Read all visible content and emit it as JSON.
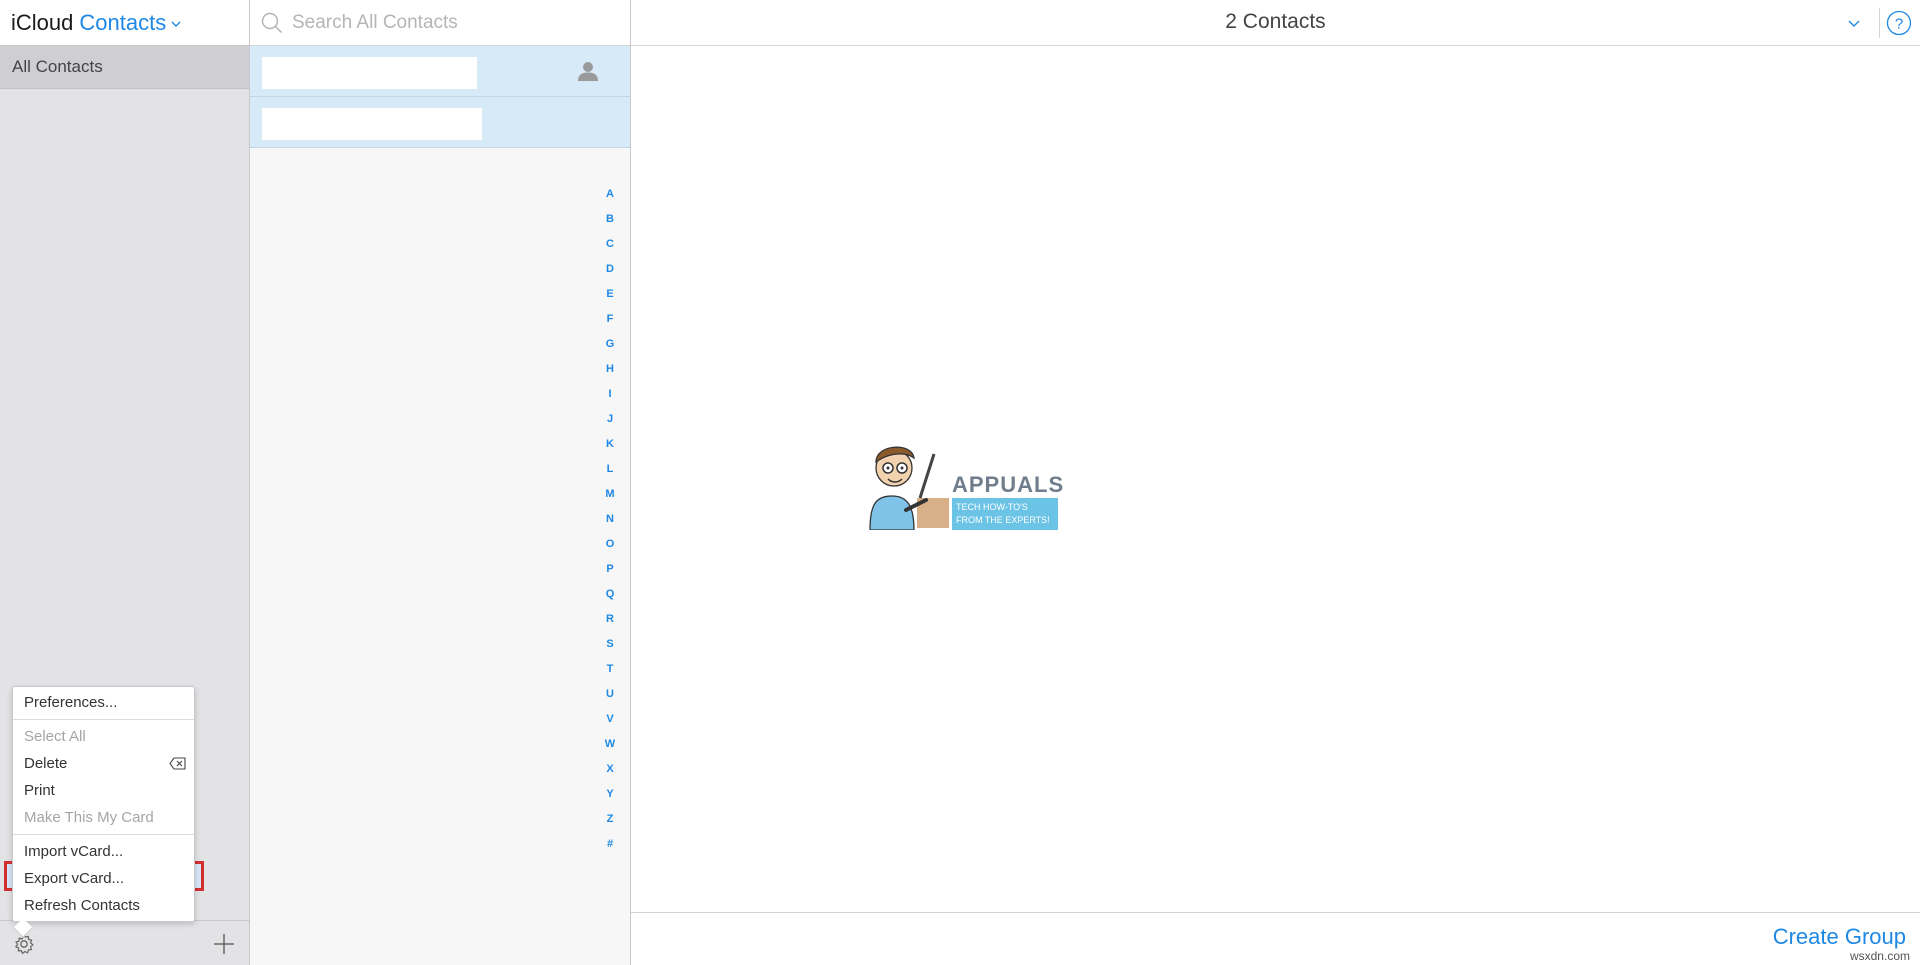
{
  "app": {
    "brand": "iCloud",
    "name": "Contacts"
  },
  "sidebar": {
    "groups": [
      {
        "label": "All Contacts"
      }
    ]
  },
  "menu": {
    "items": [
      {
        "label": "Preferences..."
      },
      {
        "label": "Select All",
        "disabled": true
      },
      {
        "label": "Delete"
      },
      {
        "label": "Print"
      },
      {
        "label": "Make This My Card",
        "disabled": true
      },
      {
        "label": "Import vCard..."
      },
      {
        "label": "Export vCard...",
        "highlighted": true
      },
      {
        "label": "Refresh Contacts"
      }
    ]
  },
  "search": {
    "placeholder": "Search All Contacts"
  },
  "index_letters": [
    "A",
    "B",
    "C",
    "D",
    "E",
    "F",
    "G",
    "H",
    "I",
    "J",
    "K",
    "L",
    "M",
    "N",
    "O",
    "P",
    "Q",
    "R",
    "S",
    "T",
    "U",
    "V",
    "W",
    "X",
    "Y",
    "Z",
    "#"
  ],
  "detail": {
    "count_label": "2 Contacts",
    "create_group": "Create Group"
  },
  "watermark": {
    "title": "APPUALS",
    "tagline": "TECH HOW-TO'S FROM THE EXPERTS!"
  },
  "credit": "wsxdn.com",
  "colors": {
    "accent": "#1e88e5",
    "selection": "#d6eaf8",
    "highlight_border": "#d32f2f"
  }
}
